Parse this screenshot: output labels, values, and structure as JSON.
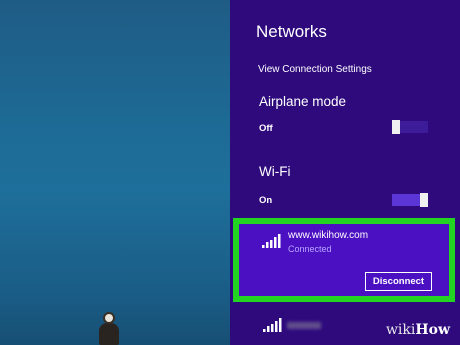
{
  "panel": {
    "title": "Networks",
    "view_connection_settings": "View Connection Settings",
    "airplane": {
      "label": "Airplane mode",
      "state": "Off",
      "on": false
    },
    "wifi": {
      "label": "Wi-Fi",
      "state": "On",
      "on": true
    },
    "connected_network": {
      "name": "www.wikihow.com",
      "status": "Connected",
      "action": "Disconnect",
      "signal_bars": 5
    },
    "other_network": {
      "signal_bars": 5
    }
  },
  "watermark": {
    "wiki": "wiki",
    "how": "How"
  },
  "colors": {
    "panel_bg": "#2e0a7d",
    "selected_network_bg": "#4b10c2",
    "highlight_border": "#22d322"
  }
}
